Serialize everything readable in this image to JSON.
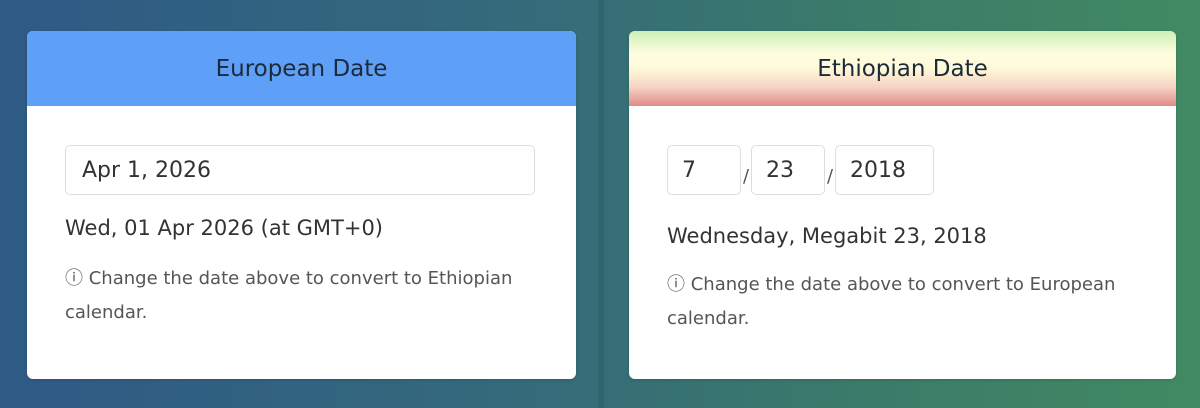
{
  "european": {
    "header": "European Date",
    "date_value": "Apr 1, 2026",
    "formatted": "Wed, 01 Apr 2026 (at GMT+0)",
    "hint_icon": "ⓘ",
    "hint": "Change the date above to convert to Ethiopian calendar.",
    "header_color": "#5e9ff7"
  },
  "ethiopian": {
    "header": "Ethiopian Date",
    "month_value": "7",
    "day_value": "23",
    "year_value": "2018",
    "separator": "/",
    "formatted": "Wednesday, Megabit 23, 2018",
    "hint_icon": "ⓘ",
    "hint": "Change the date above to convert to European calendar."
  }
}
